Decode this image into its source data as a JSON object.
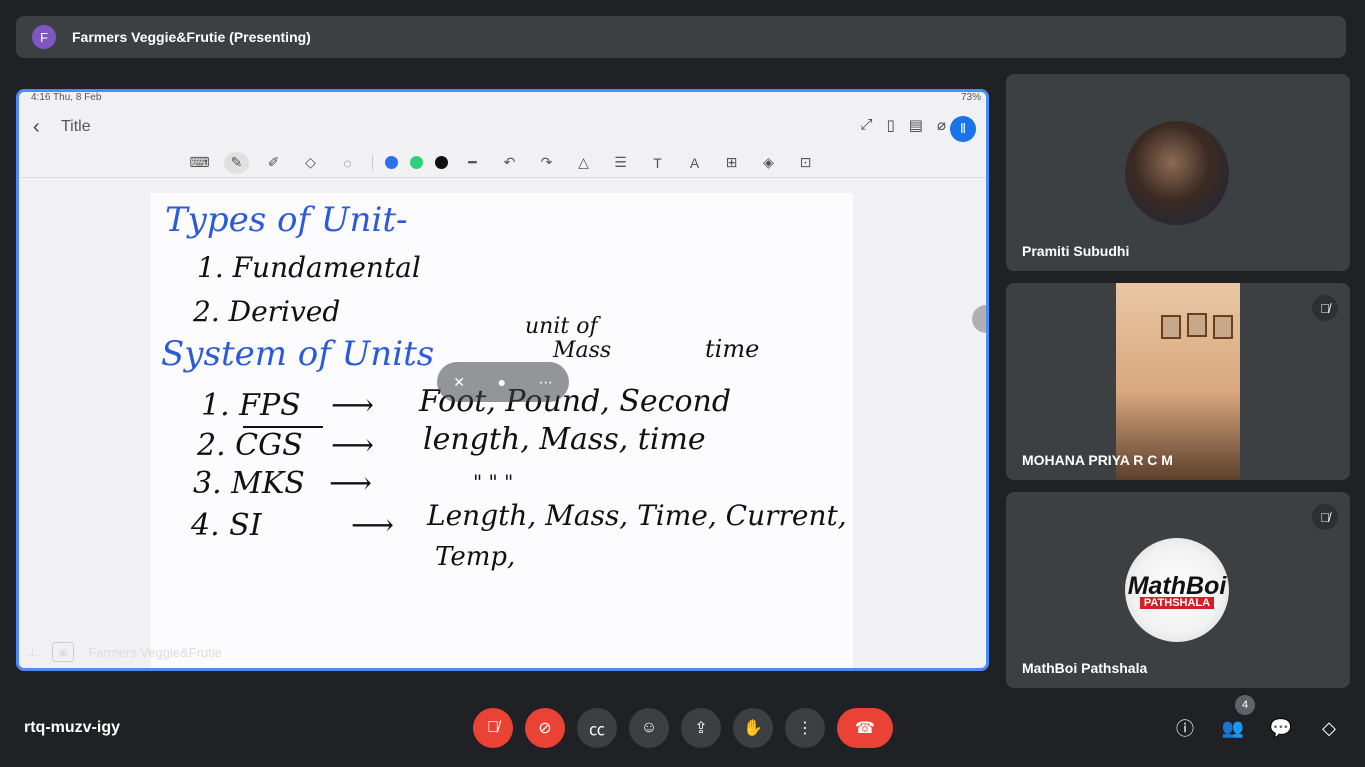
{
  "banner": {
    "avatar_letter": "F",
    "title": "Farmers Veggie&Frutie (Presenting)"
  },
  "tablet": {
    "status_left": "4:16  Thu, 8 Feb",
    "status_right": "73%",
    "doc_title": "Title",
    "presenter_label": "Farmers Veggie&Frutie",
    "pen_colors": [
      "#2f6fe8",
      "#2fd07a",
      "#111111"
    ]
  },
  "handwriting": {
    "heading": "Types of Unit-",
    "item1": "1. Fundamental",
    "item2": "2. Derived",
    "unit_of": "unit of",
    "mass": "Mass",
    "time": "time",
    "system": "System of Units",
    "row1_label": "1. FPS",
    "row1_value": "Foot, Pound, Second",
    "row2_label": "2. CGS",
    "row2_value": "length, Mass, time",
    "row3_label": "3. MKS",
    "row3_ditto": "\"  \"  \"",
    "row4_label": "4. SI",
    "row4_value": "Length, Mass, Time, Current,",
    "row4_value2": "Temp,"
  },
  "participants": [
    {
      "name": "Pramiti Subudhi",
      "muted": false
    },
    {
      "name": "MOHANA PRIYA R C M",
      "muted": true
    },
    {
      "name": "MathBoi Pathshala",
      "muted": true,
      "logo_line1": "MathBoi",
      "logo_line2": "PATHSHALA"
    }
  ],
  "meeting": {
    "code": "rtq-muzv-igy",
    "participant_count": "4"
  }
}
